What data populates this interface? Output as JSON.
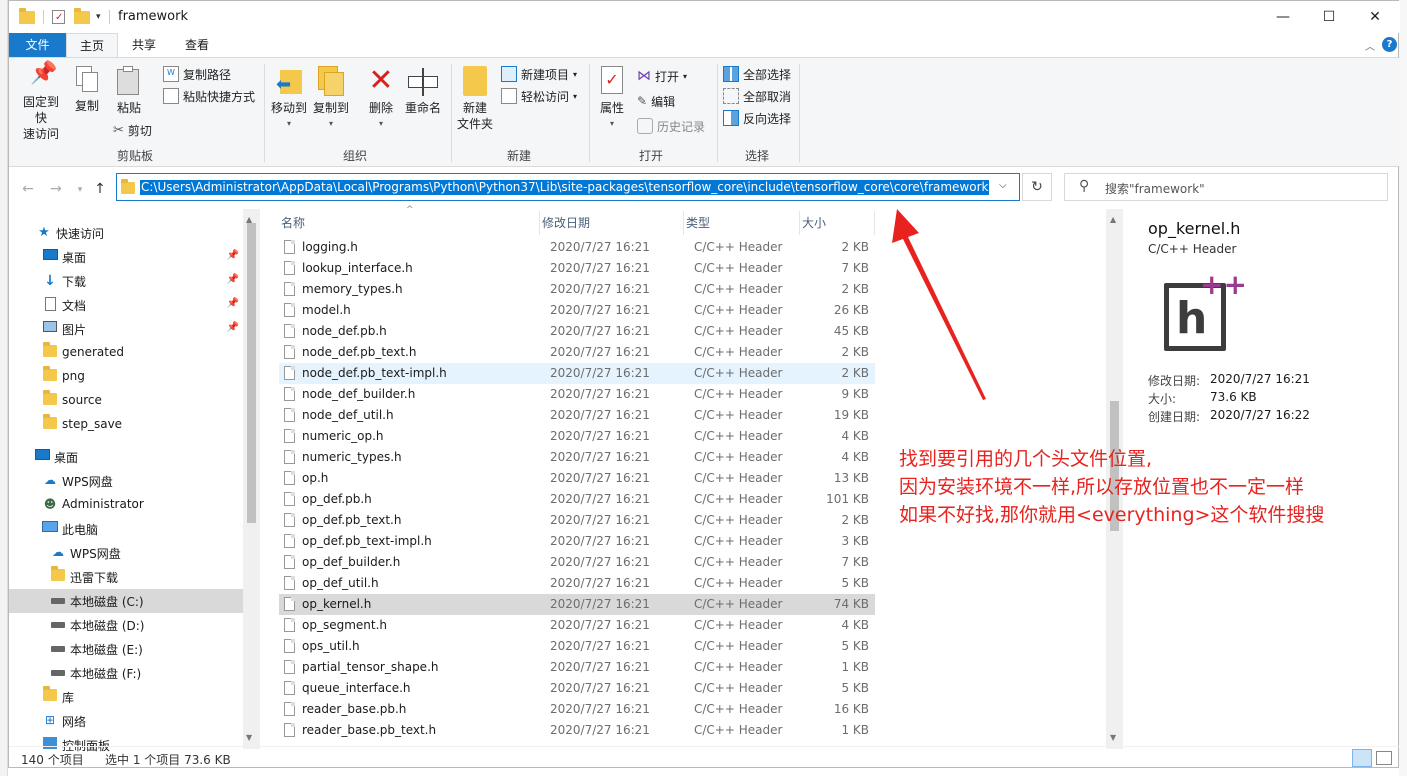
{
  "window": {
    "title": "framework",
    "minimize": "—",
    "maximize": "☐",
    "close": "✕"
  },
  "ribbon": {
    "tabs": {
      "file": "文件",
      "home": "主页",
      "share": "共享",
      "view": "查看"
    },
    "clipboard": {
      "pin": "固定到快",
      "pin2": "速访问",
      "copy": "复制",
      "paste": "粘贴",
      "copy_path": "复制路径",
      "paste_shortcut": "粘贴快捷方式",
      "cut": "剪切",
      "label": "剪贴板"
    },
    "organize": {
      "move": "移动到",
      "copy_to": "复制到",
      "delete": "删除",
      "rename": "重命名",
      "label": "组织"
    },
    "new": {
      "new_folder": "新建",
      "new_folder2": "文件夹",
      "new_item": "新建项目",
      "easy_access": "轻松访问",
      "label": "新建"
    },
    "open": {
      "properties": "属性",
      "open": "打开",
      "edit": "编辑",
      "history": "历史记录",
      "label": "打开"
    },
    "select": {
      "select_all": "全部选择",
      "select_none": "全部取消",
      "invert": "反向选择",
      "label": "选择"
    }
  },
  "address": {
    "path": "C:\\Users\\Administrator\\AppData\\Local\\Programs\\Python\\Python37\\Lib\\site-packages\\tensorflow_core\\include\\tensorflow_core\\core\\framework"
  },
  "search": {
    "placeholder": "搜索\"framework\""
  },
  "nav": [
    {
      "label": "快速访问"
    },
    {
      "label": "桌面"
    },
    {
      "label": "下载"
    },
    {
      "label": "文档"
    },
    {
      "label": "图片"
    },
    {
      "label": "generated"
    },
    {
      "label": "png"
    },
    {
      "label": "source"
    },
    {
      "label": "step_save"
    },
    {
      "label": "桌面"
    },
    {
      "label": "WPS网盘"
    },
    {
      "label": "Administrator"
    },
    {
      "label": "此电脑"
    },
    {
      "label": "WPS网盘"
    },
    {
      "label": "迅雷下载"
    },
    {
      "label": "本地磁盘 (C:)"
    },
    {
      "label": "本地磁盘 (D:)"
    },
    {
      "label": "本地磁盘 (E:)"
    },
    {
      "label": "本地磁盘 (F:)"
    },
    {
      "label": "库"
    },
    {
      "label": "网络"
    },
    {
      "label": "控制面板"
    }
  ],
  "columns": {
    "name": "名称",
    "date": "修改日期",
    "type": "类型",
    "size": "大小"
  },
  "files": [
    {
      "name": "logging.h",
      "date": "2020/7/27 16:21",
      "type": "C/C++ Header",
      "size": "2 KB"
    },
    {
      "name": "lookup_interface.h",
      "date": "2020/7/27 16:21",
      "type": "C/C++ Header",
      "size": "7 KB"
    },
    {
      "name": "memory_types.h",
      "date": "2020/7/27 16:21",
      "type": "C/C++ Header",
      "size": "2 KB"
    },
    {
      "name": "model.h",
      "date": "2020/7/27 16:21",
      "type": "C/C++ Header",
      "size": "26 KB"
    },
    {
      "name": "node_def.pb.h",
      "date": "2020/7/27 16:21",
      "type": "C/C++ Header",
      "size": "45 KB"
    },
    {
      "name": "node_def.pb_text.h",
      "date": "2020/7/27 16:21",
      "type": "C/C++ Header",
      "size": "2 KB"
    },
    {
      "name": "node_def.pb_text-impl.h",
      "date": "2020/7/27 16:21",
      "type": "C/C++ Header",
      "size": "2 KB"
    },
    {
      "name": "node_def_builder.h",
      "date": "2020/7/27 16:21",
      "type": "C/C++ Header",
      "size": "9 KB"
    },
    {
      "name": "node_def_util.h",
      "date": "2020/7/27 16:21",
      "type": "C/C++ Header",
      "size": "19 KB"
    },
    {
      "name": "numeric_op.h",
      "date": "2020/7/27 16:21",
      "type": "C/C++ Header",
      "size": "4 KB"
    },
    {
      "name": "numeric_types.h",
      "date": "2020/7/27 16:21",
      "type": "C/C++ Header",
      "size": "4 KB"
    },
    {
      "name": "op.h",
      "date": "2020/7/27 16:21",
      "type": "C/C++ Header",
      "size": "13 KB"
    },
    {
      "name": "op_def.pb.h",
      "date": "2020/7/27 16:21",
      "type": "C/C++ Header",
      "size": "101 KB"
    },
    {
      "name": "op_def.pb_text.h",
      "date": "2020/7/27 16:21",
      "type": "C/C++ Header",
      "size": "2 KB"
    },
    {
      "name": "op_def.pb_text-impl.h",
      "date": "2020/7/27 16:21",
      "type": "C/C++ Header",
      "size": "3 KB"
    },
    {
      "name": "op_def_builder.h",
      "date": "2020/7/27 16:21",
      "type": "C/C++ Header",
      "size": "7 KB"
    },
    {
      "name": "op_def_util.h",
      "date": "2020/7/27 16:21",
      "type": "C/C++ Header",
      "size": "5 KB"
    },
    {
      "name": "op_kernel.h",
      "date": "2020/7/27 16:21",
      "type": "C/C++ Header",
      "size": "74 KB"
    },
    {
      "name": "op_segment.h",
      "date": "2020/7/27 16:21",
      "type": "C/C++ Header",
      "size": "4 KB"
    },
    {
      "name": "ops_util.h",
      "date": "2020/7/27 16:21",
      "type": "C/C++ Header",
      "size": "5 KB"
    },
    {
      "name": "partial_tensor_shape.h",
      "date": "2020/7/27 16:21",
      "type": "C/C++ Header",
      "size": "1 KB"
    },
    {
      "name": "queue_interface.h",
      "date": "2020/7/27 16:21",
      "type": "C/C++ Header",
      "size": "5 KB"
    },
    {
      "name": "reader_base.pb.h",
      "date": "2020/7/27 16:21",
      "type": "C/C++ Header",
      "size": "16 KB"
    },
    {
      "name": "reader_base.pb_text.h",
      "date": "2020/7/27 16:21",
      "type": "C/C++ Header",
      "size": "1 KB"
    }
  ],
  "preview": {
    "filename": "op_kernel.h",
    "filetype": "C/C++ Header",
    "mod_label": "修改日期:",
    "mod_value": "2020/7/27 16:21",
    "size_label": "大小:",
    "size_value": "73.6 KB",
    "created_label": "创建日期:",
    "created_value": "2020/7/27 16:22"
  },
  "annotation": {
    "line1": "找到要引用的几个头文件位置,",
    "line2": "因为安装环境不一样,所以存放位置也不一定一样",
    "line3": "如果不好找,那你就用<everything>这个软件搜搜"
  },
  "status": {
    "count": "140 个项目",
    "selected": "选中 1 个项目  73.6 KB"
  },
  "colors": {
    "accent": "#1979ca",
    "annotation": "#e8231f",
    "selection": "#d9d9d9"
  }
}
